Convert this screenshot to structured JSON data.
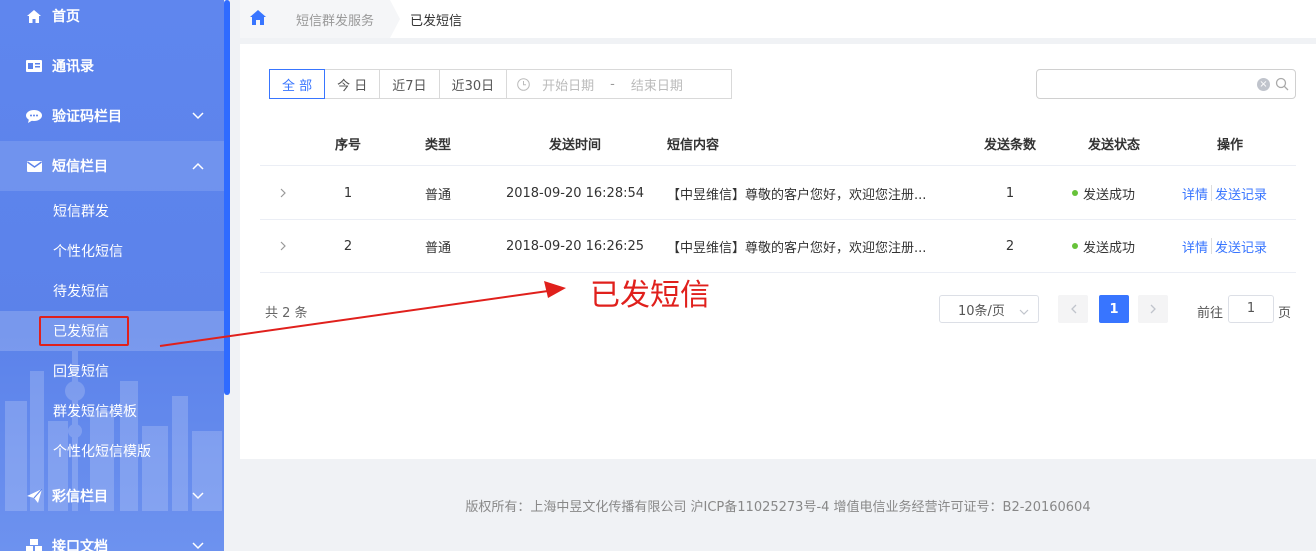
{
  "sidebar": {
    "home": "首页",
    "contacts": "通讯录",
    "verify": "验证码栏目",
    "sms": "短信栏目",
    "sms_items": [
      "短信群发",
      "个性化短信",
      "待发短信",
      "已发短信",
      "回复短信",
      "群发短信模板",
      "个性化短信模版"
    ],
    "mms": "彩信栏目",
    "api": "接口文档"
  },
  "breadcrumb": {
    "parent": "短信群发服务",
    "current": "已发短信"
  },
  "filters": {
    "all": "全 部",
    "today": "今 日",
    "last7": "近7日",
    "last30": "近30日",
    "start_placeholder": "开始日期",
    "separator": "-",
    "end_placeholder": "结束日期"
  },
  "table": {
    "headers": [
      "序号",
      "类型",
      "发送时间",
      "短信内容",
      "发送条数",
      "发送状态",
      "操作"
    ],
    "rows": [
      {
        "index": "1",
        "type": "普通",
        "time": "2018-09-20 16:28:54",
        "content": "【中昱维信】尊敬的客户您好，欢迎您注册...",
        "count": "1",
        "status": "发送成功",
        "detail": "详情",
        "records": "发送记录"
      },
      {
        "index": "2",
        "type": "普通",
        "time": "2018-09-20 16:26:25",
        "content": "【中昱维信】尊敬的客户您好，欢迎您注册...",
        "count": "2",
        "status": "发送成功",
        "detail": "详情",
        "records": "发送记录"
      }
    ]
  },
  "pagination": {
    "total": "共 2 条",
    "page_size": "10条/页",
    "current_page": "1",
    "goto_label": "前往",
    "goto_value": "1",
    "page_unit": "页"
  },
  "annotation": "已发短信",
  "footer": "版权所有：上海中昱文化传播有限公司 沪ICP备11025273号-4 增值电信业务经营许可证号：B2-20160604",
  "colors": {
    "sidebar": "#5b82ea",
    "accent": "#3875ff",
    "annotation": "#e0201c",
    "success": "#67c23a"
  }
}
